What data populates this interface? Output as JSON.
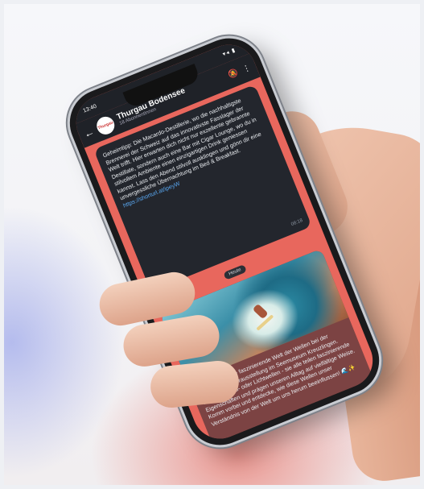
{
  "status": {
    "time": "13:40",
    "icons": "▾◂ ▮"
  },
  "channel": {
    "name": "Thurgau Bodensee",
    "subscribers": "18 AbonnentInnen",
    "avatar_text": "Thurgau"
  },
  "topbar_icons": {
    "back": "back-arrow-icon",
    "bell": "bell-muted-icon",
    "menu": "more-vert-icon"
  },
  "messages": [
    {
      "text": "Geheimtipp: Die Macardo-Destillerie, wo die nachhaltigste Brennerei der Schweiz auf das innovativste Fasslager der Welt trifft. Hier erwarten dich nicht nur exzellente gebrannte Destillate, sondern auch eine Bar mit Cigar Lounge, wo du in stilvollem Ambiente einen einzigartigen Drink geniessen kannst. Lass den Abend stilvoll ausklingen und gönn dir eine unvergessliche Übernachtung im Bed & Breakfast.",
      "link": "https://shorturl.at/ipeyW",
      "time": "08:18",
      "reaction": "👍"
    },
    {
      "text": "Tauche ein in die faszinierende Welt der Wellen bei der aktuellen Sonderausstellung im Seemuseum Kreuzlingen. Wasser, Schall- oder Lichtwellen - sie alle teilen faszinierende Eigenschaften und prägen unseren Alltag auf vielfältige Weise. Komm vorbei und entdecke, wie diese Wellen unser Verständnis von der Welt um uns herum beeinflussen! 🌊✨"
    }
  ],
  "day_chip": "Heute",
  "colors": {
    "screen_bg": "#e8675d",
    "bubble_bg": "#23262d",
    "link": "#5aa8f2"
  }
}
